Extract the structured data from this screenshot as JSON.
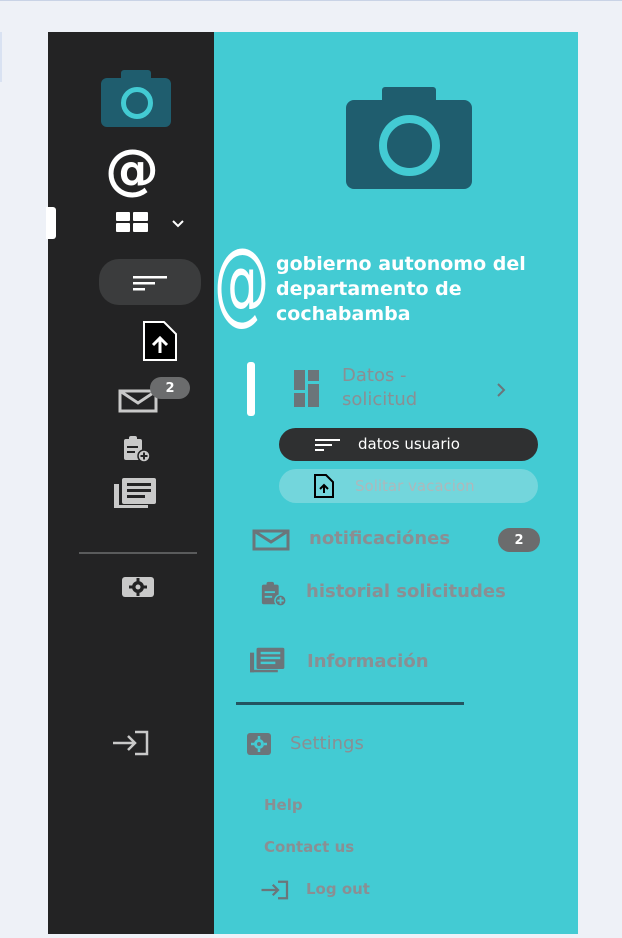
{
  "org": {
    "name": "gobierno autonomo del departamento de cochabamba"
  },
  "rail": {
    "messages_badge": "2"
  },
  "menu": {
    "group_label": "Datos - solicitud",
    "submenu": {
      "user_data": "datos usuario",
      "request_vacation": "Solitar vacacion"
    },
    "notifications": "notificaciónes",
    "notifications_badge": "2",
    "history": "historial solicitudes",
    "info": "Información",
    "settings": "Settings",
    "help": "Help",
    "contact": "Contact us",
    "logout": "Log out"
  },
  "icons": {
    "camera": "camera-icon",
    "at": "at-sign-icon",
    "dashboard": "dashboard-icon",
    "chevron_down": "chevron-down-icon",
    "chevron_right": "chevron-right-icon",
    "sort": "sort-icon",
    "upload": "upload-file-icon",
    "mail": "mail-icon",
    "clipboard": "clipboard-add-icon",
    "news": "news-icon",
    "settings": "settings-icon",
    "logout": "logout-icon"
  },
  "colors": {
    "rail_bg": "#232324",
    "panel_bg": "#43cbd3",
    "accent_dark": "#1f5d6e",
    "pill_dark": "#2f3031",
    "muted_text": "#8a8f93"
  }
}
